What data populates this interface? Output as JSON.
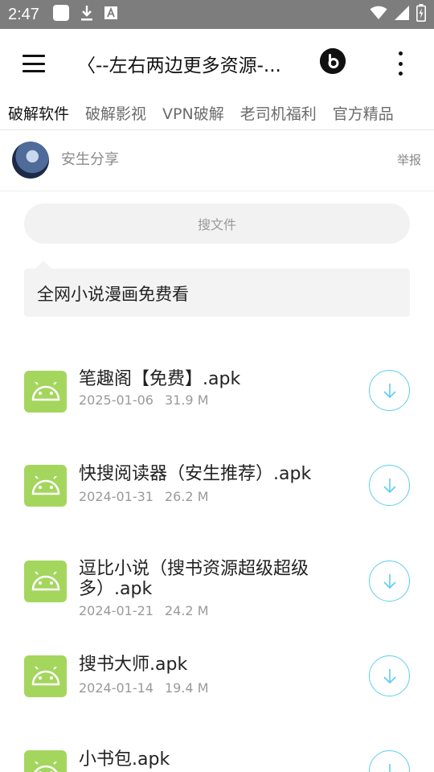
{
  "status_bar": {
    "time": "2:47"
  },
  "app_bar": {
    "title": "〈--左右两边更多资源-..."
  },
  "tabs": [
    {
      "label": "破解软件",
      "active": true
    },
    {
      "label": "破解影视"
    },
    {
      "label": "VPN破解"
    },
    {
      "label": "老司机福利"
    },
    {
      "label": "官方精品"
    }
  ],
  "user": {
    "name": "安生分享",
    "report_label": "举报"
  },
  "search": {
    "placeholder": "搜文件"
  },
  "notice": {
    "text": "全网小说漫画免费看"
  },
  "files": [
    {
      "name": "笔趣阁【免费】.apk",
      "date": "2025-01-06",
      "size": "31.9 M"
    },
    {
      "name": "快搜阅读器（安生推荐）.apk",
      "date": "2024-01-31",
      "size": "26.2 M"
    },
    {
      "name": "逗比小说（搜书资源超级超级多）.apk",
      "date": "2024-01-21",
      "size": "24.2 M"
    },
    {
      "name": "搜书大师.apk",
      "date": "2024-01-14",
      "size": "19.4 M"
    },
    {
      "name": "小书包.apk",
      "date": "",
      "size": ""
    }
  ],
  "icons": {
    "menu": "hamburger-menu-icon",
    "more": "more-vert-icon",
    "beats": "beats-logo-icon",
    "apk": "android-icon",
    "download": "download-circle-icon"
  },
  "colors": {
    "status_bar": "#7d7d7d",
    "android_green": "#a4d65e",
    "download_accent": "#5ecdf1"
  }
}
